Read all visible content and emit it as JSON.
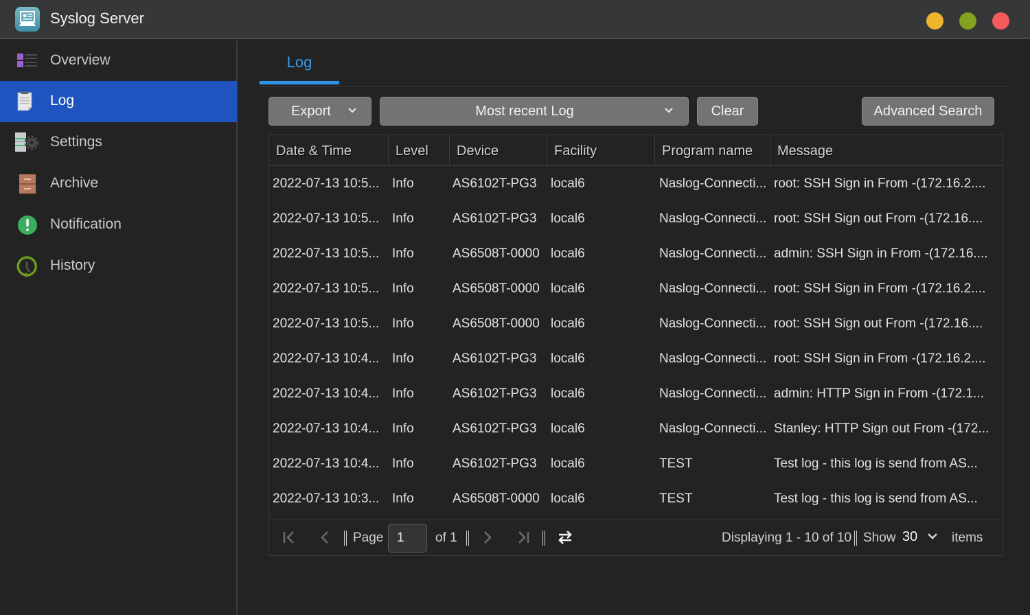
{
  "window": {
    "title": "Syslog Server",
    "controls": {
      "minimize_color": "#f0b52e",
      "maximize_color": "#85a21f",
      "close_color": "#f55b5d"
    }
  },
  "sidebar": {
    "active_color": "#1f54c0",
    "items": [
      {
        "label": "Overview",
        "icon": "overview-list-icon",
        "active": false
      },
      {
        "label": "Log",
        "icon": "log-clipboard-icon",
        "active": true
      },
      {
        "label": "Settings",
        "icon": "settings-server-gear-icon",
        "active": false
      },
      {
        "label": "Archive",
        "icon": "archive-drawer-icon",
        "active": false
      },
      {
        "label": "Notification",
        "icon": "notification-exclamation-icon",
        "active": false
      },
      {
        "label": "History",
        "icon": "history-clock-icon",
        "active": false
      }
    ]
  },
  "main": {
    "tabs": [
      {
        "label": "Log",
        "active": true
      }
    ],
    "accent_color": "#2e95ea",
    "toolbar": {
      "export_label": "Export",
      "range_selected": "Most recent Log",
      "clear_label": "Clear",
      "advanced_search_label": "Advanced Search"
    },
    "table": {
      "columns": [
        "Date & Time",
        "Level",
        "Device",
        "Facility",
        "Program name",
        "Message"
      ],
      "rows": [
        [
          "2022-07-13 10:5...",
          "Info",
          "AS6102T-PG3",
          "local6",
          "Naslog-Connecti...",
          "root: SSH Sign in From -(172.16.2...."
        ],
        [
          "2022-07-13 10:5...",
          "Info",
          "AS6102T-PG3",
          "local6",
          "Naslog-Connecti...",
          "root: SSH Sign out From -(172.16...."
        ],
        [
          "2022-07-13 10:5...",
          "Info",
          "AS6508T-0000",
          "local6",
          "Naslog-Connecti...",
          "admin: SSH Sign in From -(172.16...."
        ],
        [
          "2022-07-13 10:5...",
          "Info",
          "AS6508T-0000",
          "local6",
          "Naslog-Connecti...",
          "root: SSH Sign in From -(172.16.2...."
        ],
        [
          "2022-07-13 10:5...",
          "Info",
          "AS6508T-0000",
          "local6",
          "Naslog-Connecti...",
          "root: SSH Sign out From -(172.16...."
        ],
        [
          "2022-07-13 10:4...",
          "Info",
          "AS6102T-PG3",
          "local6",
          "Naslog-Connecti...",
          "root: SSH Sign in From -(172.16.2...."
        ],
        [
          "2022-07-13 10:4...",
          "Info",
          "AS6102T-PG3",
          "local6",
          "Naslog-Connecti...",
          "admin: HTTP Sign in From -(172.1..."
        ],
        [
          "2022-07-13 10:4...",
          "Info",
          "AS6102T-PG3",
          "local6",
          "Naslog-Connecti...",
          "Stanley: HTTP Sign out From -(172..."
        ],
        [
          "2022-07-13 10:4...",
          "Info",
          "AS6102T-PG3",
          "local6",
          "TEST",
          "Test log - this log is send from AS..."
        ],
        [
          "2022-07-13 10:3...",
          "Info",
          "AS6508T-0000",
          "local6",
          "TEST",
          "Test log - this log is send from AS..."
        ]
      ]
    },
    "pager": {
      "page_label": "Page",
      "page_value": "1",
      "of_label": "of 1",
      "displaying": "Displaying 1 - 10 of 10",
      "show_label": "Show",
      "show_value": "30",
      "items_label": "items"
    }
  }
}
